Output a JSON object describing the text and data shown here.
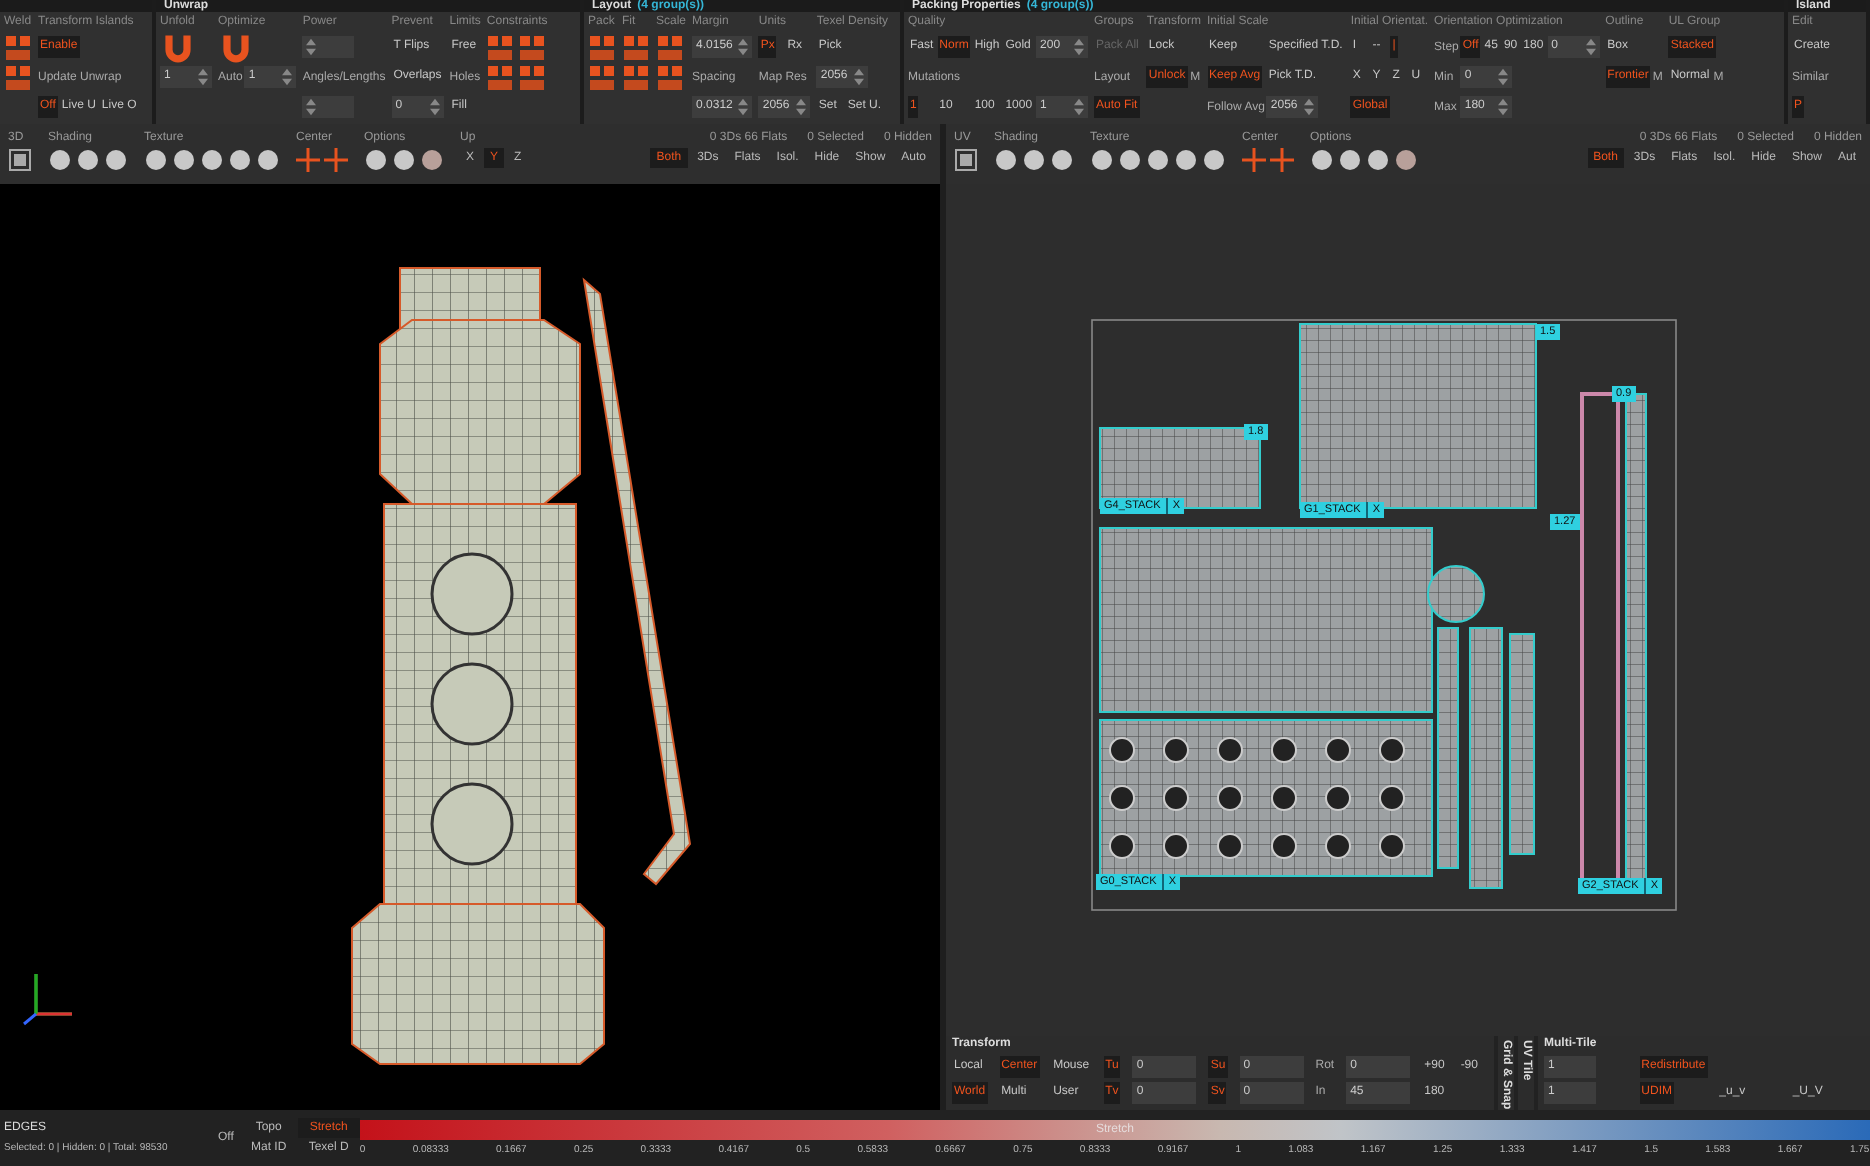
{
  "panels": [
    {
      "columns": [
        {
          "label": "Weld",
          "rows": [
            [
              {
                "kind": "icon"
              }
            ],
            [
              {
                "kind": "icon"
              }
            ]
          ]
        },
        {
          "label": "Transform Islands",
          "rows": [
            [
              {
                "kind": "btn",
                "text": "Enable",
                "selected": true
              }
            ],
            [
              {
                "kind": "label",
                "text": "Update Unwrap"
              }
            ],
            [
              {
                "kind": "btn",
                "text": "Off",
                "selected": true
              },
              {
                "kind": "btn",
                "text": "Live U",
                "selected": false
              },
              {
                "kind": "btn",
                "text": "Live O",
                "selected": false
              }
            ]
          ]
        }
      ]
    },
    {
      "title": "Unwrap",
      "columns": [
        {
          "label": "Unfold",
          "rows": [
            [
              {
                "kind": "bigicon"
              }
            ],
            [
              {
                "kind": "field",
                "text": "1"
              }
            ]
          ]
        },
        {
          "label": "Optimize",
          "rows": [
            [
              {
                "kind": "bigicon"
              }
            ],
            [
              {
                "kind": "label",
                "text": "Auto"
              },
              {
                "kind": "field",
                "text": "1"
              }
            ]
          ]
        },
        {
          "label": "Power",
          "rows": [
            [
              {
                "kind": "field"
              }
            ],
            [
              {
                "kind": "label",
                "text": "Angles/Lengths"
              }
            ],
            [
              {
                "kind": "field"
              }
            ]
          ]
        },
        {
          "label": "Prevent",
          "rows": [
            [
              {
                "kind": "btn",
                "text": "T Flips",
                "selected": false
              }
            ],
            [
              {
                "kind": "btn",
                "text": "Overlaps",
                "selected": false
              }
            ],
            [
              {
                "kind": "field",
                "text": "0"
              }
            ]
          ]
        },
        {
          "label": "Limits",
          "rows": [
            [
              {
                "kind": "btn",
                "text": "Free",
                "selected": false
              }
            ],
            [
              {
                "kind": "label",
                "text": "Holes"
              }
            ],
            [
              {
                "kind": "btn",
                "text": "Fill",
                "selected": false
              }
            ]
          ]
        },
        {
          "label": "Constraints",
          "rows": [
            [
              {
                "kind": "icon"
              },
              {
                "kind": "icon"
              }
            ],
            [
              {
                "kind": "icon"
              },
              {
                "kind": "icon"
              }
            ]
          ]
        }
      ]
    },
    {
      "title": "Layout",
      "count": "(4 group(s))",
      "columns": [
        {
          "label": "Pack",
          "rows": [
            [
              {
                "kind": "icon"
              }
            ],
            [
              {
                "kind": "icon"
              }
            ]
          ]
        },
        {
          "label": "Fit",
          "rows": [
            [
              {
                "kind": "icon"
              }
            ],
            [
              {
                "kind": "icon"
              }
            ]
          ]
        },
        {
          "label": "Scale",
          "rows": [
            [
              {
                "kind": "icon"
              }
            ],
            [
              {
                "kind": "icon"
              }
            ]
          ]
        },
        {
          "label": "Margin",
          "rows": [
            [
              {
                "kind": "field",
                "text": "4.0156"
              }
            ],
            [
              {
                "kind": "label",
                "text": "Spacing"
              }
            ],
            [
              {
                "kind": "field",
                "text": "0.0312"
              }
            ]
          ]
        },
        {
          "label": "Units",
          "rows": [
            [
              {
                "kind": "btn",
                "text": "Px",
                "selected": true
              },
              {
                "kind": "btn",
                "text": "Rx",
                "selected": false
              }
            ],
            [
              {
                "kind": "label",
                "text": "Map Res"
              }
            ],
            [
              {
                "kind": "field",
                "text": "2056"
              }
            ]
          ]
        },
        {
          "label": "Texel Density",
          "rows": [
            [
              {
                "kind": "btn",
                "text": "Pick",
                "selected": false
              }
            ],
            [
              {
                "kind": "field",
                "text": "2056"
              }
            ],
            [
              {
                "kind": "btn",
                "text": "Set",
                "selected": false
              },
              {
                "kind": "btn",
                "text": "Set U.",
                "selected": false
              }
            ]
          ]
        }
      ]
    },
    {
      "title": "Packing Properties",
      "count": "(4 group(s))",
      "columns": [
        {
          "label": "Quality",
          "rows": [
            [
              {
                "kind": "btn",
                "text": "Fast",
                "selected": false
              },
              {
                "kind": "btn",
                "text": "Norm",
                "selected": true
              },
              {
                "kind": "btn",
                "text": "High",
                "selected": false
              },
              {
                "kind": "btn",
                "text": "Gold",
                "selected": false
              },
              {
                "kind": "field",
                "text": "200"
              }
            ],
            [
              {
                "kind": "label",
                "text": "Mutations"
              }
            ],
            [
              {
                "kind": "btn",
                "text": "1",
                "selected": true
              },
              {
                "kind": "btn",
                "text": "10",
                "selected": false
              },
              {
                "kind": "btn",
                "text": "100",
                "selected": false
              },
              {
                "kind": "btn",
                "text": "1000",
                "selected": false
              },
              {
                "kind": "field",
                "text": "1"
              }
            ]
          ]
        },
        {
          "label": "Groups",
          "rows": [
            [
              {
                "kind": "btn",
                "text": "Pack All",
                "selected": false,
                "disabled": true
              }
            ],
            [
              {
                "kind": "label",
                "text": "Layout"
              }
            ],
            [
              {
                "kind": "btn",
                "text": "Auto Fit",
                "selected": true
              }
            ]
          ]
        },
        {
          "label": "Transform",
          "rows": [
            [
              {
                "kind": "btn",
                "text": "Lock",
                "selected": false
              }
            ],
            [
              {
                "kind": "btn",
                "text": "Unlock",
                "selected": true
              },
              {
                "kind": "label",
                "text": "M"
              }
            ]
          ]
        },
        {
          "label": "Initial Scale",
          "rows": [
            [
              {
                "kind": "btn",
                "text": "Keep",
                "selected": false
              },
              {
                "kind": "btn",
                "text": "Specified T.D.",
                "selected": false
              }
            ],
            [
              {
                "kind": "btn",
                "text": "Keep Avg",
                "selected": true
              },
              {
                "kind": "btn",
                "text": "Pick T.D.",
                "selected": false
              }
            ],
            [
              {
                "kind": "label",
                "text": "Follow Avg"
              },
              {
                "kind": "field",
                "text": "2056"
              }
            ]
          ]
        },
        {
          "label": "Initial Orientat.",
          "rows": [
            [
              {
                "kind": "btn",
                "text": "I",
                "selected": false
              },
              {
                "kind": "btn",
                "text": "--",
                "selected": false
              },
              {
                "kind": "btn",
                "text": "|",
                "selected": true
              }
            ],
            [
              {
                "kind": "btn",
                "text": "X",
                "selected": false
              },
              {
                "kind": "btn",
                "text": "Y",
                "selected": false
              },
              {
                "kind": "btn",
                "text": "Z",
                "selected": false
              },
              {
                "kind": "btn",
                "text": "U",
                "selected": false
              }
            ],
            [
              {
                "kind": "btn",
                "text": "Global",
                "selected": true
              }
            ]
          ]
        },
        {
          "label": "Orientation Optimization",
          "rows": [
            [
              {
                "kind": "label",
                "text": "Step"
              },
              {
                "kind": "btn",
                "text": "Off",
                "selected": true
              },
              {
                "kind": "btn",
                "text": "45",
                "selected": false
              },
              {
                "kind": "btn",
                "text": "90",
                "selected": false
              },
              {
                "kind": "btn",
                "text": "180",
                "selected": false
              },
              {
                "kind": "field",
                "text": "0"
              }
            ],
            [
              {
                "kind": "label",
                "text": "Min"
              },
              {
                "kind": "field",
                "text": "0"
              }
            ],
            [
              {
                "kind": "label",
                "text": "Max"
              },
              {
                "kind": "field",
                "text": "180"
              }
            ]
          ]
        },
        {
          "label": "Outline",
          "rows": [
            [
              {
                "kind": "btn",
                "text": "Box",
                "selected": false
              }
            ],
            [
              {
                "kind": "btn",
                "text": "Frontier",
                "selected": true
              },
              {
                "kind": "label",
                "text": "M"
              }
            ]
          ]
        },
        {
          "label": "UL Group",
          "rows": [
            [
              {
                "kind": "btn",
                "text": "Stacked",
                "selected": true
              }
            ],
            [
              {
                "kind": "btn",
                "text": "Normal",
                "selected": false
              },
              {
                "kind": "label",
                "text": "M"
              }
            ]
          ]
        }
      ]
    },
    {
      "title": "Island",
      "columns": [
        {
          "label": "Edit",
          "rows": [
            [
              {
                "kind": "btn",
                "text": "Create",
                "selected": false
              }
            ],
            [
              {
                "kind": "label",
                "text": "Similar"
              }
            ],
            [
              {
                "kind": "btn",
                "text": "P",
                "selected": true
              }
            ]
          ]
        }
      ]
    }
  ],
  "viewports": [
    {
      "name": "3D",
      "groups": [
        "Shading",
        "Texture",
        "Center",
        "Options",
        "Up"
      ],
      "axes": [
        {
          "label": "X",
          "selected": false
        },
        {
          "label": "Y",
          "selected": true
        },
        {
          "label": "Z",
          "selected": false
        }
      ],
      "stats": [
        "0 3Ds 66 Flats",
        "0 Selected",
        "0 Hidden"
      ],
      "filters": [
        {
          "label": "Both",
          "selected": true
        },
        {
          "label": "3Ds",
          "selected": false
        },
        {
          "label": "Flats",
          "selected": false
        },
        {
          "label": "Isol.",
          "selected": false
        },
        {
          "label": "Hide",
          "selected": false
        },
        {
          "label": "Show",
          "selected": false
        },
        {
          "label": "Auto",
          "selected": false
        }
      ]
    },
    {
      "name": "UV",
      "groups": [
        "Shading",
        "Texture",
        "Center",
        "Options"
      ],
      "stats": [
        "0 3Ds 66 Flats",
        "0 Selected",
        "0 Hidden"
      ],
      "filters": [
        {
          "label": "Both",
          "selected": true
        },
        {
          "label": "3Ds",
          "selected": false
        },
        {
          "label": "Flats",
          "selected": false
        },
        {
          "label": "Isol.",
          "selected": false
        },
        {
          "label": "Hide",
          "selected": false
        },
        {
          "label": "Show",
          "selected": false
        },
        {
          "label": "Aut",
          "selected": false
        }
      ]
    }
  ],
  "uv_tags": [
    {
      "text": "1.5"
    },
    {
      "text": "1.8"
    },
    {
      "text": "G4_STACK",
      "close": "X"
    },
    {
      "text": "G1_STACK",
      "close": "X"
    },
    {
      "text": "1.27"
    },
    {
      "text": "0.9"
    },
    {
      "text": "G0_STACK",
      "close": "X"
    },
    {
      "text": "G2_STACK",
      "close": "X"
    }
  ],
  "transform": {
    "title": "Transform",
    "rows": [
      [
        {
          "kind": "btn",
          "text": "Local",
          "selected": false
        },
        {
          "kind": "btn",
          "text": "Center",
          "selected": true
        },
        {
          "kind": "btn",
          "text": "Mouse",
          "selected": false
        },
        {
          "kind": "btn",
          "text": "Tu",
          "selected": true
        },
        {
          "kind": "field",
          "text": "0"
        },
        {
          "kind": "btn",
          "text": "Su",
          "selected": true
        },
        {
          "kind": "field",
          "text": "0"
        },
        {
          "kind": "label",
          "text": "Rot"
        },
        {
          "kind": "field",
          "text": "0"
        },
        {
          "kind": "btn",
          "text": "+90",
          "selected": false
        },
        {
          "kind": "btn",
          "text": "-90",
          "selected": false
        }
      ],
      [
        {
          "kind": "btn",
          "text": "World",
          "selected": true
        },
        {
          "kind": "btn",
          "text": "Multi",
          "selected": false
        },
        {
          "kind": "btn",
          "text": "User",
          "selected": false
        },
        {
          "kind": "btn",
          "text": "Tv",
          "selected": true
        },
        {
          "kind": "field",
          "text": "0"
        },
        {
          "kind": "btn",
          "text": "Sv",
          "selected": true
        },
        {
          "kind": "field",
          "text": "0"
        },
        {
          "kind": "label",
          "text": "In"
        },
        {
          "kind": "field",
          "text": "45"
        },
        {
          "kind": "btn",
          "text": "180",
          "selected": false
        }
      ]
    ]
  },
  "side_tabs": [
    "Grid & Snap",
    "UV Tile"
  ],
  "multi_tile": {
    "title": "Multi-Tile",
    "rows": [
      [
        {
          "kind": "field",
          "text": "1"
        },
        {
          "kind": "btn",
          "text": "Redistribute",
          "selected": true
        }
      ],
      [
        {
          "kind": "field",
          "text": "1"
        },
        {
          "kind": "btn",
          "text": "UDIM",
          "selected": true
        },
        {
          "kind": "btn",
          "text": "_u_v",
          "selected": false
        },
        {
          "kind": "btn",
          "text": "_U_V",
          "selected": false
        }
      ]
    ]
  },
  "status_bar": {
    "mode": "EDGES",
    "info": "Selected: 0 | Hidden: 0 | Total: 98530",
    "off": "Off",
    "display": [
      {
        "label": "Topo",
        "selected": false
      },
      {
        "label": "Stretch",
        "selected": true
      },
      {
        "label": "Mat ID",
        "selected": false
      },
      {
        "label": "Texel D",
        "selected": false
      }
    ],
    "legend_title": "Stretch",
    "legend_ticks": [
      "0",
      "0.08333",
      "0.1667",
      "0.25",
      "0.3333",
      "0.4167",
      "0.5",
      "0.5833",
      "0.6667",
      "0.75",
      "0.8333",
      "0.9167",
      "1",
      "1.083",
      "1.167",
      "1.25",
      "1.333",
      "1.417",
      "1.5",
      "1.583",
      "1.667",
      "1.75"
    ]
  }
}
